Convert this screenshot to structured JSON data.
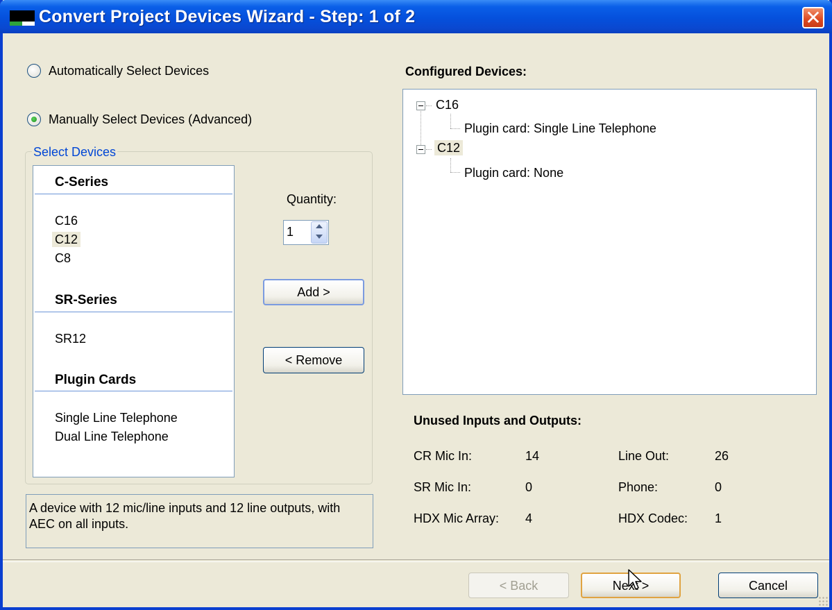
{
  "window": {
    "title": "Convert Project Devices Wizard - Step: 1 of 2",
    "close_symbol": "✕"
  },
  "selection_mode": {
    "auto_label": "Automatically Select Devices",
    "manual_label": "Manually Select Devices (Advanced)",
    "selected": "manual"
  },
  "select_devices": {
    "legend": "Select Devices",
    "groups": [
      {
        "header": "C-Series",
        "items": [
          "C16",
          "C12",
          "C8"
        ]
      },
      {
        "header": "SR-Series",
        "items": [
          "SR12"
        ]
      },
      {
        "header": "Plugin Cards",
        "items": [
          "Single Line Telephone",
          "Dual Line Telephone"
        ]
      }
    ],
    "selected_item": "C12"
  },
  "quantity": {
    "label": "Quantity:",
    "value": "1"
  },
  "buttons": {
    "add": "Add >",
    "remove": "< Remove",
    "back": "< Back",
    "next": "Next >",
    "cancel": "Cancel"
  },
  "configured": {
    "heading": "Configured Devices:",
    "tree": [
      {
        "device": "C16",
        "child": "Plugin card: Single Line Telephone"
      },
      {
        "device": "C12",
        "child": "Plugin card: None"
      }
    ]
  },
  "description": "A device with 12 mic/line inputs and 12 line outputs, with AEC on all inputs.",
  "unused": {
    "heading": "Unused Inputs and Outputs:",
    "rows": [
      {
        "left_label": "CR Mic In:",
        "left_value": "14",
        "right_label": "Line Out:",
        "right_value": "26"
      },
      {
        "left_label": "SR Mic In:",
        "left_value": "0",
        "right_label": "Phone:",
        "right_value": "0"
      },
      {
        "left_label": "HDX Mic Array:",
        "left_value": "4",
        "right_label": "HDX Codec:",
        "right_value": "1"
      }
    ]
  },
  "colors": {
    "titlebar": "#0550dc",
    "window_bg": "#ece9d8",
    "group_legend": "#0046d5",
    "selection_highlight": "#ece9d8"
  }
}
